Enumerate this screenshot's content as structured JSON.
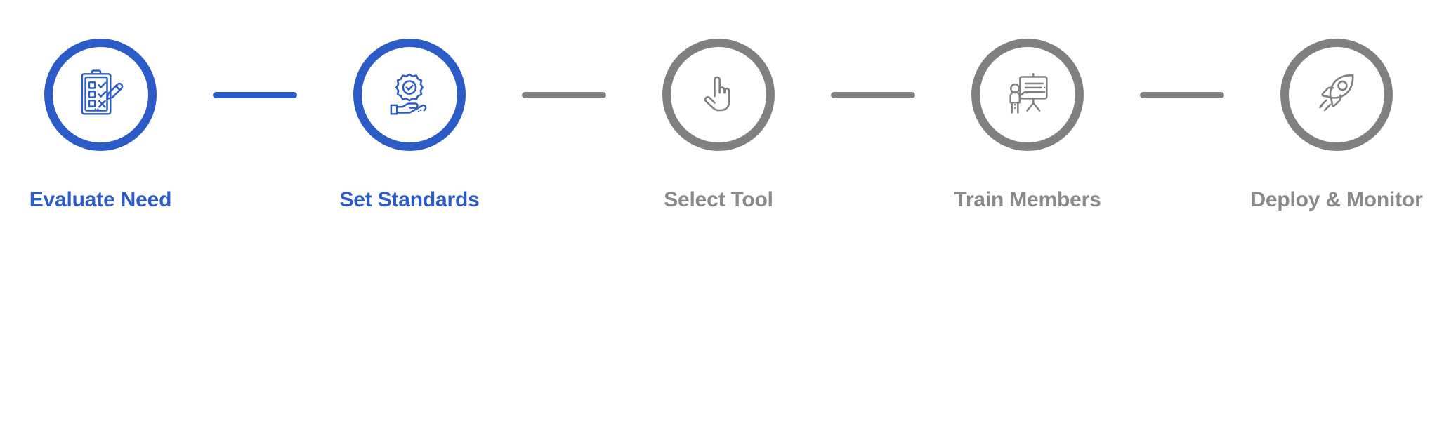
{
  "diagram": {
    "type": "horizontal-step-progress",
    "title": "",
    "colors": {
      "active": "#2b5bc6",
      "inactive": "#808080",
      "label_inactive": "#8a8a8a",
      "background": "#ffffff"
    },
    "steps": [
      {
        "index": 1,
        "label": "Evaluate Need",
        "icon": "clipboard-checklist-pencil-icon",
        "state": "active"
      },
      {
        "index": 2,
        "label": "Set Standards",
        "icon": "hand-holding-quality-badge-icon",
        "state": "active"
      },
      {
        "index": 3,
        "label": "Select Tool",
        "icon": "pointing-hand-click-icon",
        "state": "inactive"
      },
      {
        "index": 4,
        "label": "Train Members",
        "icon": "presenter-whiteboard-training-icon",
        "state": "inactive"
      },
      {
        "index": 5,
        "label": "Deploy & Monitor",
        "icon": "rocket-launch-icon",
        "state": "inactive"
      }
    ],
    "connectors": [
      {
        "index": 1,
        "from": "Evaluate Need",
        "to": "Set Standards",
        "state": "active"
      },
      {
        "index": 2,
        "from": "Set Standards",
        "to": "Select Tool",
        "state": "inactive"
      },
      {
        "index": 3,
        "from": "Select Tool",
        "to": "Train Members",
        "state": "inactive"
      },
      {
        "index": 4,
        "from": "Train Members",
        "to": "Deploy & Monitor",
        "state": "inactive"
      }
    ]
  }
}
